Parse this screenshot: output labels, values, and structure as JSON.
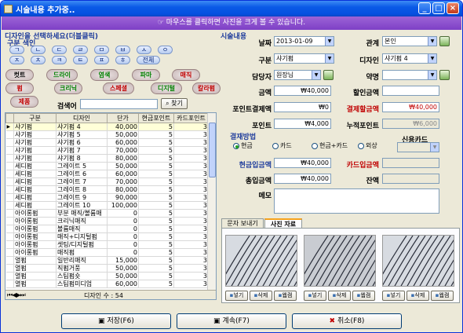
{
  "window": {
    "title": "시술내용 추가중..",
    "min": "_",
    "max": "□",
    "close": "×"
  },
  "banner": "☞ 마우스를 클릭하면 사진을 크게 볼 수 있습니다.",
  "left": {
    "title": "디자인을 선택하세요(더블클릭)",
    "category_title": "구분 색인",
    "consonants": [
      "ㄱ",
      "ㄴ",
      "ㄷ",
      "ㄹ",
      "ㅁ",
      "ㅂ",
      "ㅅ",
      "ㅇ",
      "ㅈ",
      "ㅊ",
      "ㅋ",
      "ㅌ",
      "ㅍ",
      "ㅎ",
      "전체"
    ],
    "categories": [
      "컷트",
      "드라이",
      "염색",
      "파마",
      "매직",
      "펌",
      "크리닉",
      "스페셜",
      "디지털",
      "칼라펌",
      "제품"
    ],
    "search_label": "검색어",
    "search_value": "",
    "search_button": "찾기",
    "columns": [
      "구분",
      "디자인",
      "단가",
      "현금포인트",
      "카드포인트"
    ],
    "rows": [
      [
        "샤기펌",
        "샤기펌 4",
        "40,000",
        "5",
        "3"
      ],
      [
        "샤기펌",
        "샤기펌 5",
        "50,000",
        "5",
        "3"
      ],
      [
        "샤기펌",
        "샤기펌 6",
        "60,000",
        "5",
        "3"
      ],
      [
        "샤기펌",
        "샤기펌 7",
        "70,000",
        "5",
        "3"
      ],
      [
        "샤기펌",
        "샤기펌 8",
        "80,000",
        "5",
        "3"
      ],
      [
        "세디펌",
        "그레이트 5",
        "50,000",
        "5",
        "3"
      ],
      [
        "세디펌",
        "그레이트 6",
        "60,000",
        "5",
        "3"
      ],
      [
        "세디펌",
        "그레이트 7",
        "70,000",
        "5",
        "3"
      ],
      [
        "세디펌",
        "그레이트 8",
        "80,000",
        "5",
        "3"
      ],
      [
        "세디펌",
        "그레이트 9",
        "90,000",
        "5",
        "3"
      ],
      [
        "세디펌",
        "그레이트 10",
        "100,000",
        "5",
        "3"
      ],
      [
        "아이롱펌",
        "부분 매직/볼륨매",
        "0",
        "5",
        "3"
      ],
      [
        "아이롱펌",
        "크리닉매직",
        "0",
        "5",
        "3"
      ],
      [
        "아이롱펌",
        "볼륨매직",
        "0",
        "5",
        "3"
      ],
      [
        "아이롱펌",
        "매직+디지털펌",
        "0",
        "5",
        "3"
      ],
      [
        "아이롱펌",
        "셋팅/디지털펌",
        "0",
        "5",
        "3"
      ],
      [
        "아이롱펌",
        "매직펌",
        "0",
        "5",
        "3"
      ],
      [
        "열펌",
        "일반리매직",
        "15,000",
        "5",
        "3"
      ],
      [
        "열펌",
        "직펌거풍",
        "50,000",
        "5",
        "3"
      ],
      [
        "열펌",
        "스팀펌숏",
        "50,000",
        "5",
        "3"
      ],
      [
        "열펌",
        "스팀펌미디엄",
        "60,000",
        "5",
        "3"
      ]
    ],
    "count_label": "디자인 수 : 54"
  },
  "right": {
    "title": "시술내용",
    "date_label": "날짜",
    "date_value": "2013-01-09",
    "relation_label": "관계",
    "relation_value": "본인",
    "type_label": "구분",
    "type_value": "샤기펌",
    "design_label": "디자인",
    "design_value": "샤기펌 4",
    "staff_label": "담당자",
    "staff_value": "원장님",
    "medicine_label": "약명",
    "medicine_value": "",
    "price_label": "금액",
    "price_value": "₩40,000",
    "discount_label": "할인금액",
    "discount_value": "",
    "point_pay_label": "포인트결제액",
    "point_pay_value": "₩0",
    "pay_amount_label": "결제할금액",
    "pay_amount_value": "₩40,000",
    "point_label": "포인트",
    "point_value": "₩4,000",
    "acc_point_label": "누적포인트",
    "acc_point_value": "₩6,000",
    "pay_method_label": "결재방법",
    "pay_methods": [
      "현금",
      "카드",
      "현금+카드",
      "외상"
    ],
    "credit_card_label": "신용카드",
    "cash_input_label": "현금입금액",
    "cash_input_value": "₩40,000",
    "card_input_label": "카드입금액",
    "card_input_value": "",
    "total_input_label": "총입금액",
    "total_input_value": "₩40,000",
    "balance_label": "잔액",
    "balance_value": "",
    "memo_label": "메모",
    "memo_value": ""
  },
  "tabs": [
    "문자 보내기",
    "사진 자료"
  ],
  "photo_buttons": [
    "넣기",
    "삭제",
    "웹캠"
  ],
  "bottom": {
    "save": "저장(F6)",
    "continue": "계속(F7)",
    "cancel": "취소(F8)"
  },
  "colors": {
    "title": "#0a5ae6",
    "banner": "#8a4fd0",
    "red": "#c00000",
    "blue": "#1f3d9c"
  }
}
